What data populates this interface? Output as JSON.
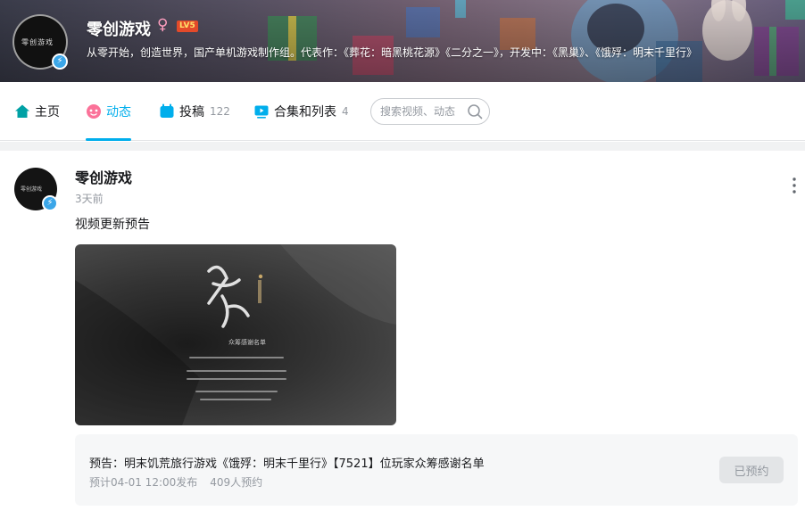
{
  "banner": {
    "name": "零创游戏",
    "gender_symbol": "♀",
    "level": "LV5",
    "sign": "从零开始，创造世界，国产单机游戏制作组。代表作：《葬花：暗黑桃花源》《二分之一》，开发中：《黑巢》、《饿殍：明末千里行》",
    "avatar_logo_text": "零创游戏",
    "badge_icon": "lightning-bolt-icon"
  },
  "nav": {
    "home_label": "主页",
    "dynamic_label": "动态",
    "posts_label": "投稿",
    "posts_count": "122",
    "collections_label": "合集和列表",
    "collections_count": "4",
    "search_placeholder": "搜索视频、动态",
    "active_tab": "动态",
    "accent_color": "#00aeec"
  },
  "post": {
    "author": "零创游戏",
    "time": "3天前",
    "text": "视频更新预告",
    "image_caption": "众筹感谢名单",
    "reserve": {
      "title": "预告：明末饥荒旅行游戏《饿殍：明末千里行》【7521】位玩家众筹感谢名单",
      "schedule": "预计04-01 12:00发布",
      "reserved_count": "409人预约",
      "button_label": "已预约"
    }
  }
}
